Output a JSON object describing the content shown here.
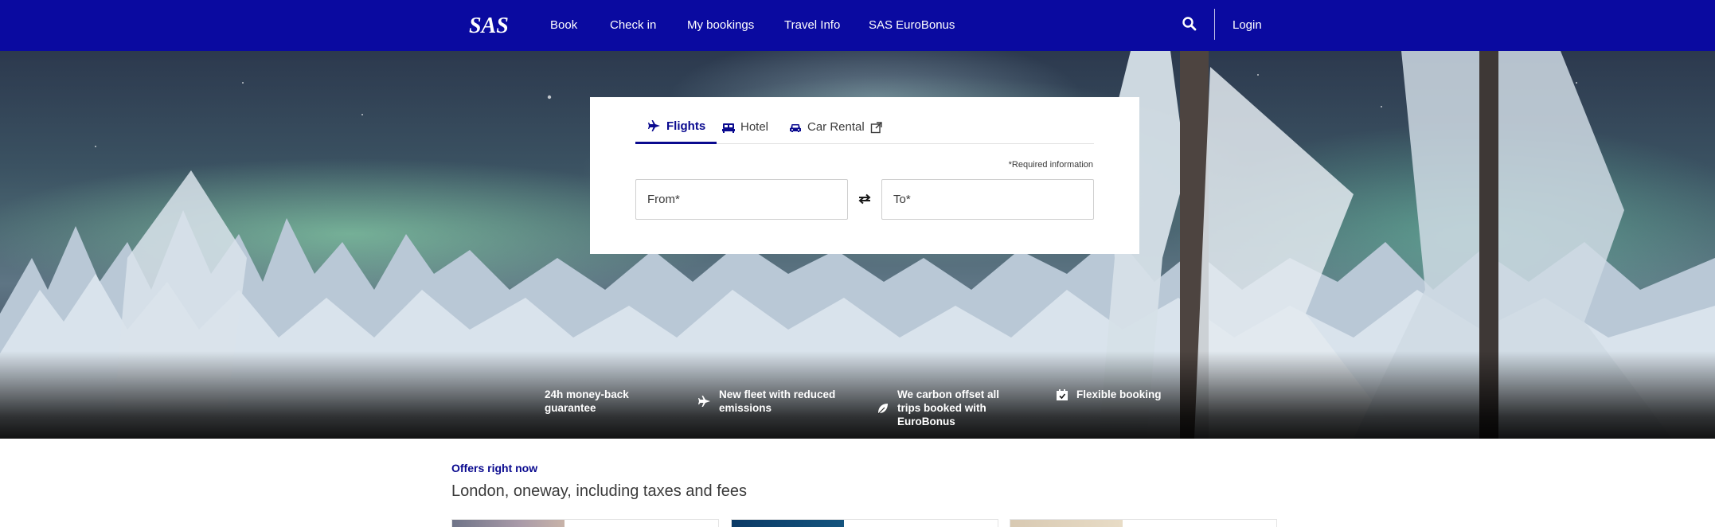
{
  "header": {
    "logo_text": "SAS",
    "nav": [
      {
        "label": "Book"
      },
      {
        "label": "Check in"
      },
      {
        "label": "My bookings"
      },
      {
        "label": "Travel Info"
      },
      {
        "label": "SAS EuroBonus"
      }
    ],
    "search_icon": "search-icon",
    "login_label": "Login"
  },
  "booking": {
    "tabs": [
      {
        "label": "Flights",
        "icon": "plane-icon",
        "active": true
      },
      {
        "label": "Hotel",
        "icon": "bed-icon",
        "active": false
      },
      {
        "label": "Car Rental",
        "icon": "car-icon",
        "external_icon": "external-link-icon",
        "active": false
      }
    ],
    "required_info": "*Required information",
    "from_placeholder": "From*",
    "to_placeholder": "To*",
    "swap_icon": "swap-arrows-icon"
  },
  "usps": [
    {
      "text": "24h money-back guarantee",
      "icon": "money-back-icon"
    },
    {
      "text": "New fleet with reduced emissions",
      "icon": "plane-icon"
    },
    {
      "text": "We carbon offset all trips booked with EuroBonus",
      "icon": "leaf-icon"
    },
    {
      "text": "Flexible booking",
      "icon": "calendar-icon"
    }
  ],
  "offers": {
    "label": "Offers right now",
    "title": "London, oneway, including taxes and fees"
  },
  "colors": {
    "brand_blue": "#0a0aa0",
    "accent_navy": "#0a0a8f",
    "text": "#3a3a3a",
    "white": "#ffffff"
  }
}
